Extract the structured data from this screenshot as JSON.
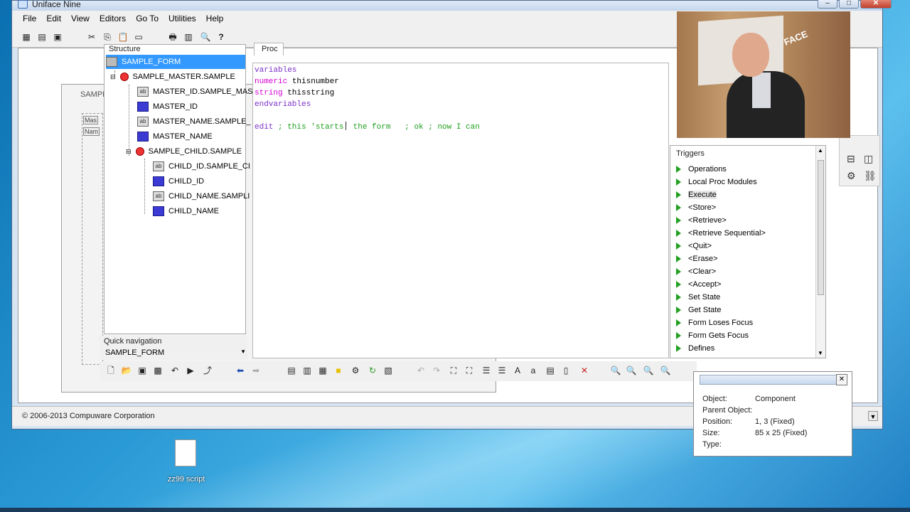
{
  "window": {
    "title": "Uniface Nine"
  },
  "menubar": [
    "File",
    "Edit",
    "View",
    "Editors",
    "Go To",
    "Utilities",
    "Help"
  ],
  "toolbar_icons": [
    "cut-icon",
    "copy-icon",
    "paste-icon",
    "new-icon",
    "print-icon",
    "print-preview-icon",
    "search-icon",
    "help-icon"
  ],
  "background_form": {
    "title": "SAMPLE",
    "labels": [
      "Mas",
      "Nam"
    ]
  },
  "structure": {
    "header": "Structure",
    "items": [
      {
        "label": "SAMPLE_FORM",
        "kind": "form",
        "selected": true
      },
      {
        "label": "SAMPLE_MASTER.SAMPLE",
        "kind": "entity"
      },
      {
        "label": "MASTER_ID.SAMPLE_MAS",
        "kind": "field"
      },
      {
        "label": "MASTER_ID",
        "kind": "label"
      },
      {
        "label": "MASTER_NAME.SAMPLE_",
        "kind": "field"
      },
      {
        "label": "MASTER_NAME",
        "kind": "label"
      },
      {
        "label": "SAMPLE_CHILD.SAMPLE",
        "kind": "entity"
      },
      {
        "label": "CHILD_ID.SAMPLE_CI",
        "kind": "field"
      },
      {
        "label": "CHILD_ID",
        "kind": "label"
      },
      {
        "label": "CHILD_NAME.SAMPLI",
        "kind": "field"
      },
      {
        "label": "CHILD_NAME",
        "kind": "label"
      }
    ]
  },
  "quick_navigation": {
    "label": "Quick navigation",
    "value": "SAMPLE_FORM"
  },
  "editor": {
    "tab": "Proc",
    "lines": [
      {
        "keyword": "variables",
        "rest": ""
      },
      {
        "keyword": "numeric",
        "rest": " thisnumber"
      },
      {
        "keyword": "string",
        "rest": " thisstring"
      },
      {
        "keyword": "endvariables",
        "rest": ""
      },
      {
        "keyword": "",
        "rest": ""
      },
      {
        "keyword": "edit",
        "comment": " ; this 'starts' the form   ; ok ; now I can"
      }
    ]
  },
  "triggers": {
    "header": "Triggers",
    "items": [
      "Operations",
      "Local Proc Modules",
      "Execute",
      "<Store>",
      "<Retrieve>",
      "<Retrieve Sequential>",
      "<Quit>",
      "<Erase>",
      "<Clear>",
      "<Accept>",
      "Set State",
      "Get State",
      "Form Loses Focus",
      "Form Gets Focus",
      "Defines"
    ],
    "selected": "Execute"
  },
  "properties": {
    "rows": [
      {
        "label": "Object:",
        "value": "Component"
      },
      {
        "label": "Parent Object:",
        "value": ""
      },
      {
        "label": "Position:",
        "value": "1, 3  (Fixed)"
      },
      {
        "label": "Size:",
        "value": "85 x 25  (Fixed)"
      },
      {
        "label": "Type:",
        "value": ""
      }
    ]
  },
  "status": {
    "copyright": "© 2006-2013 Compuware Corporation"
  },
  "webcam": {
    "logo_text": "FACE"
  },
  "desktop": {
    "file_label": "zz99 script"
  },
  "colors": {
    "selection": "#3399ff",
    "keyword": "#d400d4",
    "comment": "#20a020",
    "trigger_arrow": "#22a022"
  }
}
